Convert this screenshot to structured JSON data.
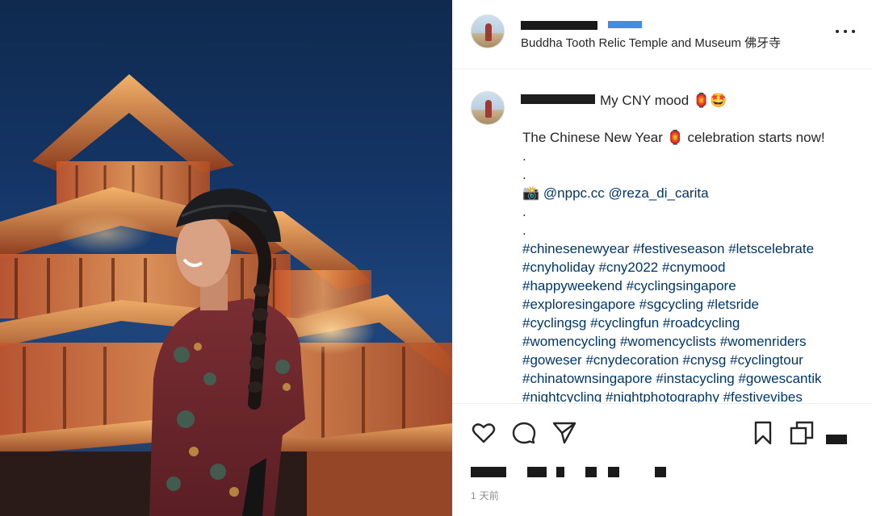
{
  "post": {
    "location": "Buddha Tooth Relic Temple and Museum 佛牙寺",
    "caption_title": "My CNY mood 🏮🤩",
    "caption_lines": [
      "The Chinese New Year 🏮 celebration starts now!",
      ".",
      "."
    ],
    "credit_prefix": "📸",
    "credits": [
      "@nppc.cc",
      "@reza_di_carita"
    ],
    "dots_after": [
      ".",
      "."
    ],
    "hashtag_lines": [
      [
        "#chinesenewyear",
        "#festiveseason",
        "#letscelebrate"
      ],
      [
        "#cnyholiday",
        "#cny2022",
        "#cnymood"
      ],
      [
        "#happyweekend",
        "#cyclingsingapore"
      ],
      [
        "#exploresingapore",
        "#sgcycling",
        "#letsride"
      ],
      [
        "#cyclingsg",
        "#cyclingfun",
        "#roadcycling"
      ],
      [
        "#womencycling",
        "#womencyclists",
        "#womenriders"
      ],
      [
        "#goweser",
        "#cnydecoration",
        "#cnysg",
        "#cyclingtour"
      ],
      [
        "#chinatownsingapore",
        "#instacycling",
        "#gowescantik"
      ],
      [
        "#nightcycling",
        "#nightphotography",
        "#festivevibes"
      ]
    ],
    "time_ago": "1 天前"
  },
  "icons": {
    "more": "more-options-icon",
    "like": "heart-icon",
    "comment": "comment-icon",
    "share": "paper-plane-icon",
    "save": "bookmark-icon",
    "multi": "copy-icon"
  },
  "colors": {
    "text": "#262626",
    "link": "#00376b",
    "muted": "#8e8e8e",
    "border": "#efefef",
    "temple_light": "#f0a050",
    "sky": "#143566"
  }
}
